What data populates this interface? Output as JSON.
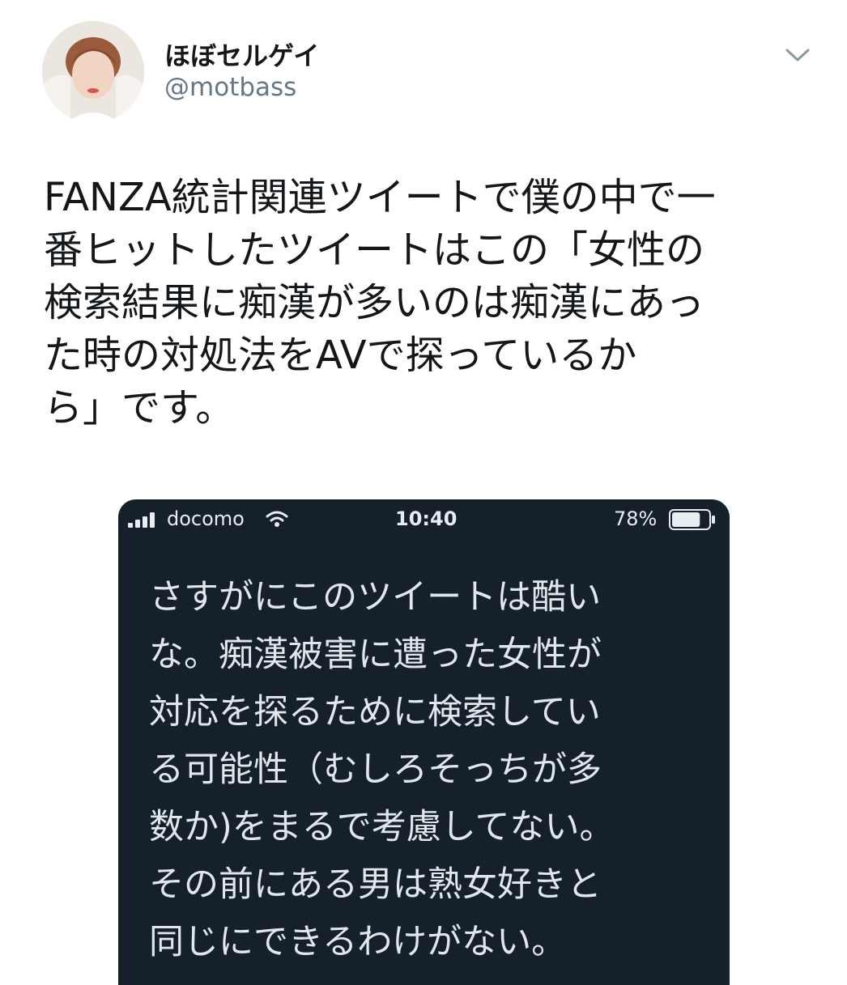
{
  "user": {
    "display_name": "ほぼセルゲイ",
    "handle": "@motbass",
    "avatar_icon": "avatar"
  },
  "tweet": {
    "lines": [
      "FANZA統計関連ツイートで僕の中で一",
      "番ヒットしたツイートはこの「女性の",
      "検索結果に痴漢が多いのは痴漢にあっ",
      "た時の対処法をAVで探っているか",
      "ら」です。"
    ]
  },
  "embedded_screenshot": {
    "status_bar": {
      "carrier": "docomo",
      "time": "10:40",
      "battery": "78%",
      "battery_level": 0.78
    },
    "lines": [
      "さすがにこのツイートは酷い",
      "な。痴漢被害に遭った女性が",
      "対応を探るために検索してい",
      "る可能性（むしろそっちが多",
      "数か)をまるで考慮してない。",
      "その前にある男は熟女好きと",
      "同じにできるわけがない。"
    ],
    "background_color": "#15202b",
    "text_color": "#e1e8ed"
  },
  "colors": {
    "name": "#14171a",
    "handle": "#657786",
    "chevron": "#8899a6"
  }
}
